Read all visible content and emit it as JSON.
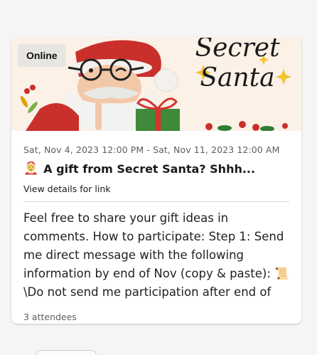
{
  "event": {
    "status_badge": "Online",
    "banner_text": "Secret Santa",
    "date_range": "Sat, Nov 4, 2023 12:00 PM - Sat, Nov 11, 2023 12:00 AM",
    "title_emoji": "🤶",
    "title": "A gift from Secret Santa? Shhh...",
    "details_link": "View details for link",
    "description": "Feel free to share your gift ideas in comments. How to participate: Step 1: Send me direct message with the following information by end of Nov (copy & paste): 📜 \\Do not send me participation after end of Nov.* \\For Privacy…",
    "attendees": "3 attendees"
  },
  "colors": {
    "banner_bg": "#fbf1e6",
    "badge_bg": "#e8e6e3",
    "santa_red": "#c9302c"
  }
}
